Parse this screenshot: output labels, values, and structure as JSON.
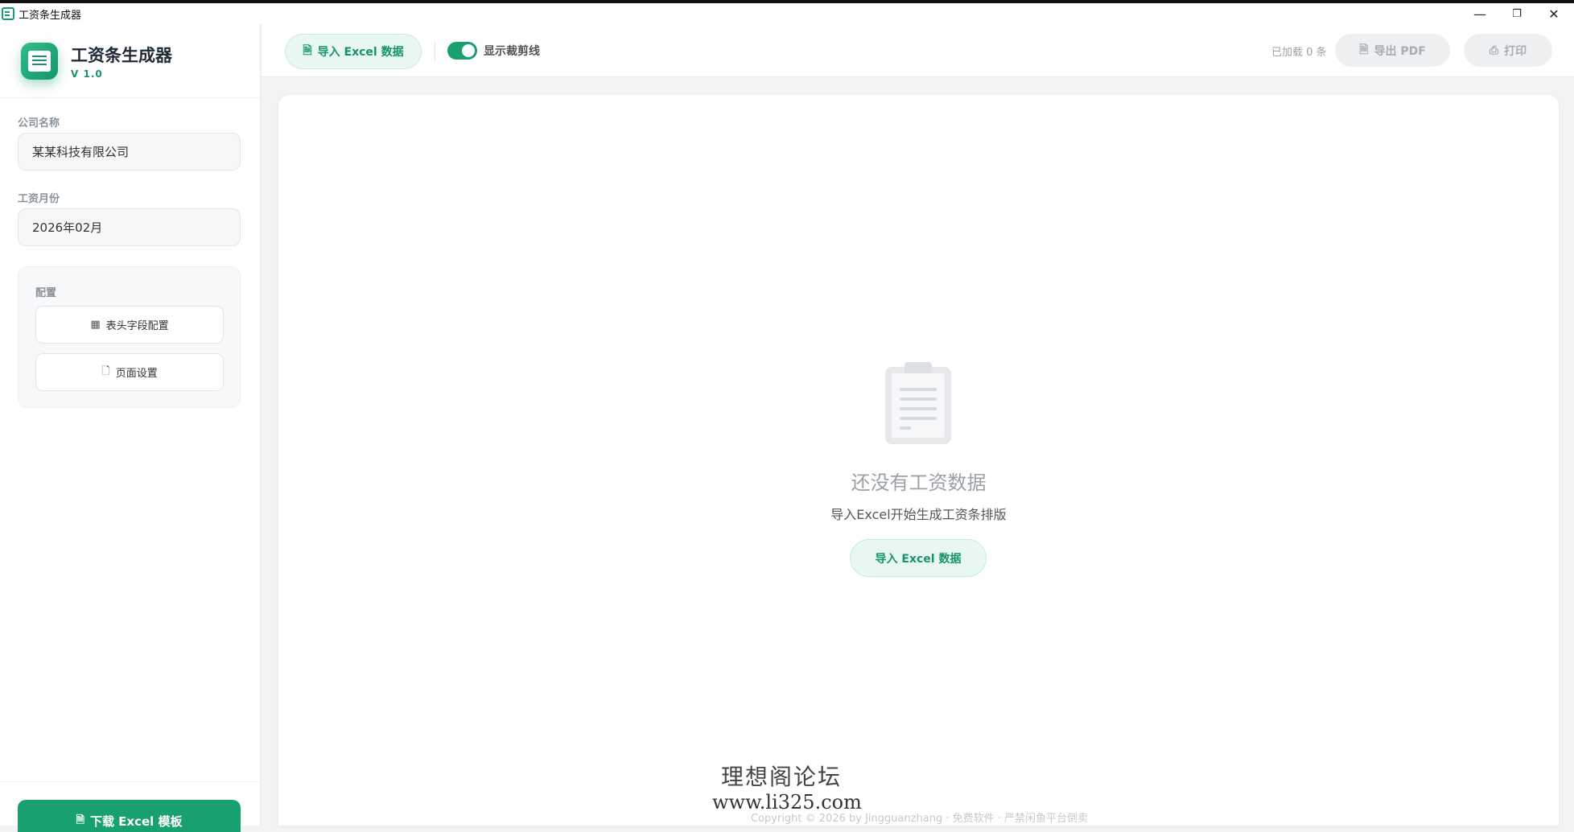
{
  "window": {
    "title": "工资条生成器",
    "controls": {
      "minimize": "—",
      "restore": "❐",
      "close": "✕"
    }
  },
  "sidebar": {
    "app_name": "工资条生成器",
    "version": "V 1.0",
    "company_label": "公司名称",
    "company_value": "某某科技有限公司",
    "month_label": "工资月份",
    "month_value": "2026年02月",
    "config_title": "配置",
    "header_config_label": "表头字段配置",
    "page_setup_label": "页面设置",
    "download_label": "下载 Excel 模板"
  },
  "toolbar": {
    "import_label": "导入 Excel 数据",
    "toggle_label": "显示裁剪线",
    "toggle_on": true,
    "loaded_text": "已加载 0 条",
    "export_pdf_label": "导出 PDF",
    "print_label": "打印"
  },
  "empty_state": {
    "title": "还没有工资数据",
    "subtitle": "导入Excel开始生成工资条排版",
    "button_label": "导入 Excel 数据"
  },
  "footer": {
    "watermark_line1": "理想阁论坛",
    "watermark_line2": "www.li325.com",
    "copyright": "Copyright © 2026 by Jingguanzhang · 免费软件 · 严禁闲鱼平台倒卖"
  },
  "colors": {
    "accent": "#18a06f",
    "accent_light": "#e9f7f1",
    "disabled": "#a6adb4"
  }
}
